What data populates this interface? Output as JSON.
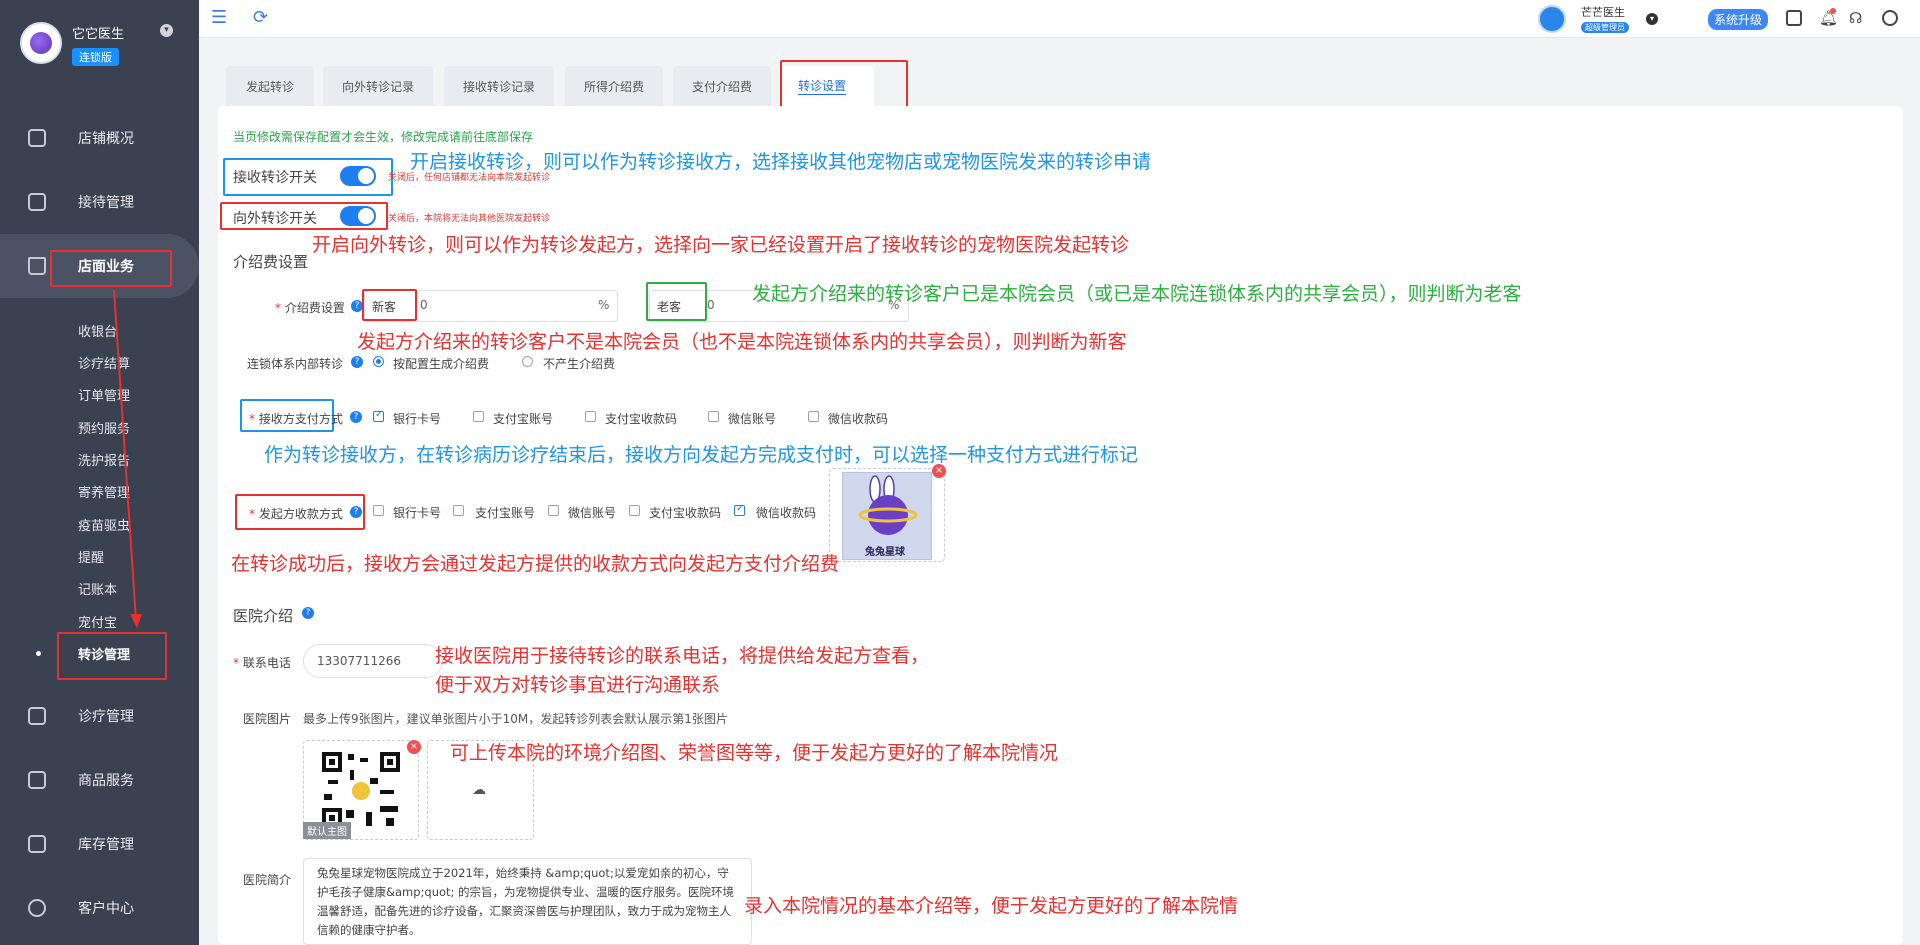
{
  "sidebar": {
    "user_name": "它它医生",
    "badge": "连锁版",
    "menu": [
      {
        "label": "店铺概况"
      },
      {
        "label": "接待管理"
      },
      {
        "label": "店面业务"
      },
      {
        "label": "诊疗管理"
      },
      {
        "label": "商品服务"
      },
      {
        "label": "库存管理"
      },
      {
        "label": "客户中心"
      }
    ],
    "submenu": [
      "收银台",
      "诊疗结算",
      "订单管理",
      "预约服务",
      "洗护报告",
      "寄养管理",
      "疫苗驱虫",
      "提醒",
      "记账本",
      "宠付宝",
      "转诊管理"
    ]
  },
  "topbar": {
    "user_name": "芒芒医生",
    "user_role": "超级管理员",
    "upgrade": "系统升级"
  },
  "tabs": [
    "发起转诊",
    "向外转诊记录",
    "接收转诊记录",
    "所得介绍费",
    "支付介绍费",
    "转诊设置"
  ],
  "form": {
    "notice": "当页修改需保存配置才会生效，修改完成请前往底部保存",
    "receive_label": "接收转诊开关",
    "receive_hint": "关闭后，任何店铺都无法向本院发起转诊",
    "outward_label": "向外转诊开关",
    "outward_hint": "关闭后，本院将无法向其他医院发起转诊",
    "fee_section": "介绍费设置",
    "fee_label": "介绍费设置",
    "new_label": "新客",
    "new_value": "0",
    "old_label": "老客",
    "old_value": "0",
    "percent": "%",
    "chain_label": "连锁体系内部转诊",
    "chain_opt1": "按配置生成介绍费",
    "chain_opt2": "不产生介绍费",
    "pay_label": "接收方支付方式",
    "pay_opts": [
      "银行卡号",
      "支付宝账号",
      "支付宝收款码",
      "微信账号",
      "微信收款码"
    ],
    "collect_label": "发起方收款方式",
    "collect_opts": [
      "银行卡号",
      "支付宝账号",
      "微信账号",
      "支付宝收款码",
      "微信收款码"
    ],
    "collect_img_caption": "兔兔星球",
    "hospital_section": "医院介绍",
    "phone_label": "联系电话",
    "phone_value": "13307711266",
    "img_label": "医院图片",
    "img_hint": "最多上传9张图片，建议单张图片小于10M，发起转诊列表会默认展示第1张图片",
    "img_default": "默认主图",
    "intro_label": "医院简介",
    "intro_text": "兔兔星球宠物医院成立于2021年，始终秉持 &amp;quot;以爱宠如亲的初心，守护毛孩子健康&amp;quot; 的宗旨，为宠物提供专业、温暖的医疗服务。医院环境温馨舒适，配备先进的诊疗设备，汇聚资深兽医与护理团队，致力于成为宠物主人信赖的健康守护者。"
  },
  "annotations": {
    "receive": "开启接收转诊，则可以作为转诊接收方，选择接收其他宠物店或宠物医院发来的转诊申请",
    "outward": "开启向外转诊，则可以作为转诊发起方，选择向一家已经设置开启了接收转诊的宠物医院发起转诊",
    "old_client": "发起方介绍来的转诊客户已是本院会员（或已是本院连锁体系内的共享会员），则判断为老客",
    "new_client": "发起方介绍来的转诊客户不是本院会员（也不是本院连锁体系内的共享会员），则判断为新客",
    "pay_method": "作为转诊接收方，在转诊病历诊疗结束后，接收方向发起方完成支付时，可以选择一种支付方式进行标记",
    "collect": "在转诊成功后，接收方会通过发起方提供的收款方式向发起方支付介绍费",
    "phone_line1": "接收医院用于接待转诊的联系电话，将提供给发起方查看，",
    "phone_line2": "便于双方对转诊事宜进行沟通联系",
    "images": "可上传本院的环境介绍图、荣誉图等等，便于发起方更好的了解本院情况",
    "intro": "录入本院情况的基本介绍等，便于发起方更好的了解本院情"
  }
}
